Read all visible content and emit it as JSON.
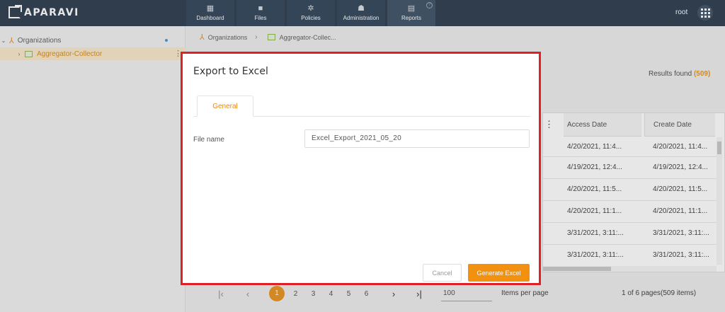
{
  "app": {
    "brand": "APARAVI",
    "user": "root"
  },
  "nav": {
    "items": [
      {
        "label": "Dashboard",
        "icon": "dashboard-icon",
        "glyph": "▦"
      },
      {
        "label": "Files",
        "icon": "folder-icon",
        "glyph": "■"
      },
      {
        "label": "Policies",
        "icon": "gear-icon",
        "glyph": "✲"
      },
      {
        "label": "Administration",
        "icon": "users-icon",
        "glyph": "☗"
      },
      {
        "label": "Reports",
        "icon": "clipboard-icon",
        "glyph": "▤"
      }
    ],
    "active": "Reports"
  },
  "sidebar": {
    "items": [
      {
        "label": "Organizations",
        "icon": "organization-icon"
      },
      {
        "label": "Aggregator-Collector",
        "icon": "image-icon"
      }
    ]
  },
  "breadcrumb": {
    "items": [
      "Organizations",
      "Aggregator-Collec..."
    ]
  },
  "results": {
    "label": "Results found",
    "count": "(509)"
  },
  "table": {
    "columns": [
      "Access Date",
      "Create Date"
    ],
    "rows": [
      [
        "4/20/2021, 11:4...",
        "4/20/2021, 11:4..."
      ],
      [
        "4/19/2021, 12:4...",
        "4/19/2021, 12:4..."
      ],
      [
        "4/20/2021, 11:5...",
        "4/20/2021, 11:5..."
      ],
      [
        "4/20/2021, 11:1...",
        "4/20/2021, 11:1..."
      ],
      [
        "3/31/2021, 3:11:...",
        "3/31/2021, 3:11:..."
      ],
      [
        "3/31/2021, 3:11:...",
        "3/31/2021, 3:11:..."
      ]
    ]
  },
  "pagination": {
    "pages": [
      "1",
      "2",
      "3",
      "4",
      "5",
      "6"
    ],
    "current": "1",
    "per_page": "100",
    "per_page_label": "Items per page",
    "info": "1 of 6 pages(509 items)"
  },
  "modal": {
    "title": "Export to Excel",
    "tab_general": "General",
    "file_name_label": "File name",
    "file_name_value": "Excel_Export_2021_05_20",
    "cancel_label": "Cancel",
    "generate_label": "Generate Excel"
  },
  "colors": {
    "accent": "#e88b10",
    "topbar": "#1f3044",
    "highlight_border": "#e02027"
  }
}
